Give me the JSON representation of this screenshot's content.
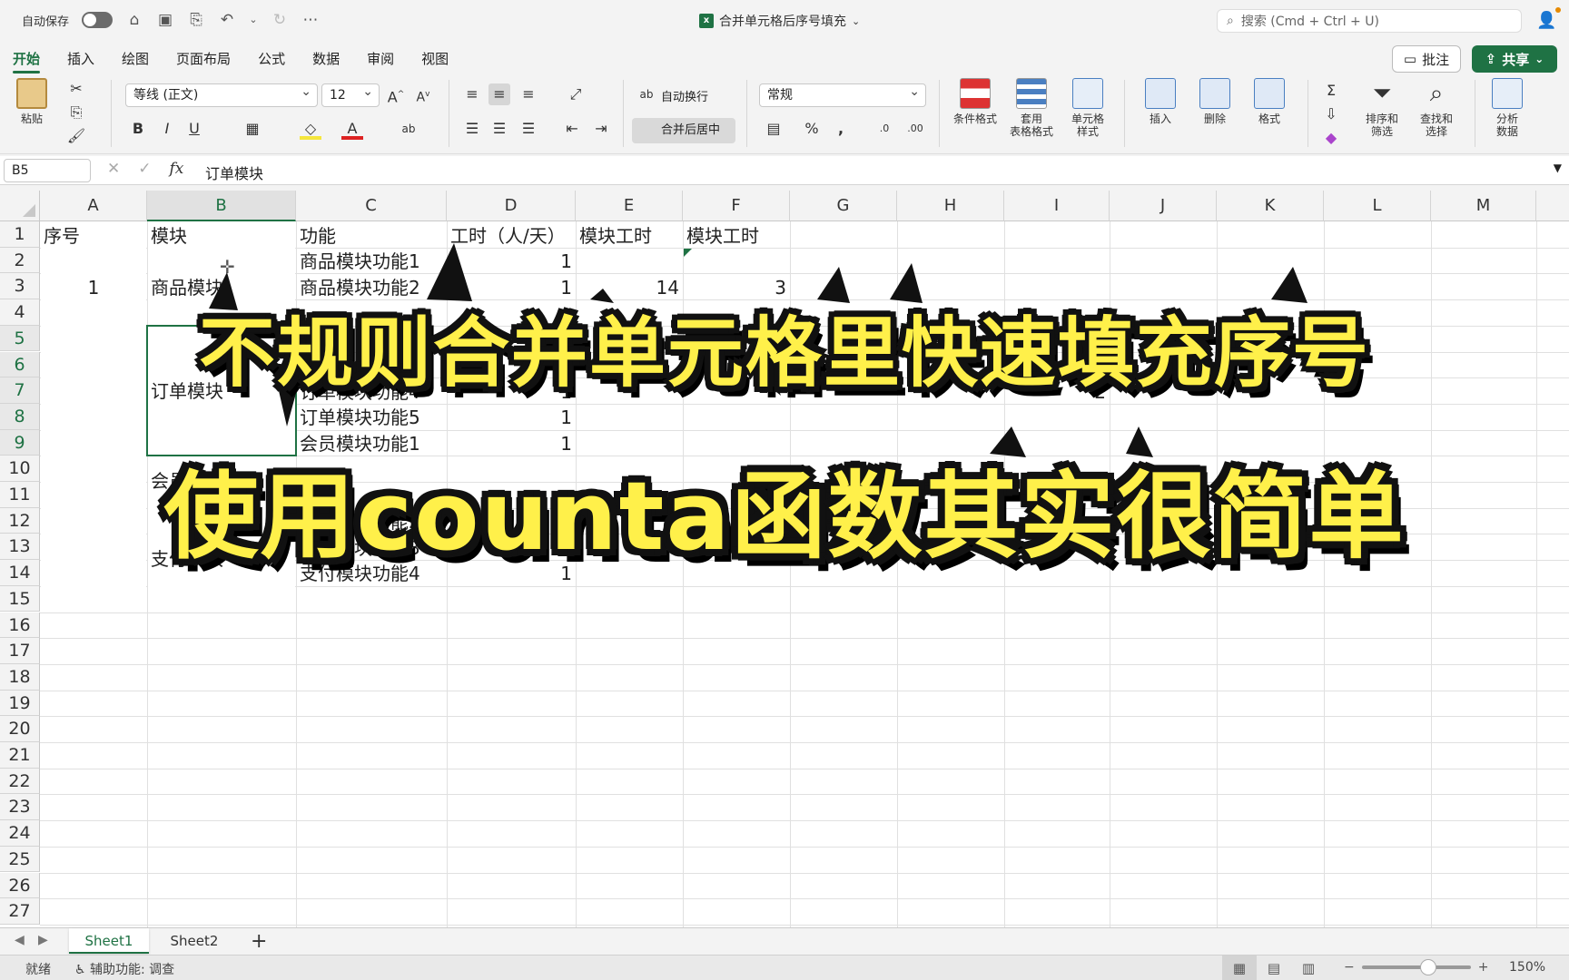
{
  "titlebar": {
    "autosave_label": "自动保存",
    "doc_title": "合并单元格后序号填充",
    "search_placeholder": "搜索 (Cmd + Ctrl + U)"
  },
  "ribbon_tabs": [
    "开始",
    "插入",
    "绘图",
    "页面布局",
    "公式",
    "数据",
    "审阅",
    "视图"
  ],
  "ribbon_buttons": {
    "comment": "批注",
    "share": "共享",
    "paste": "粘贴",
    "font_name": "等线 (正文)",
    "font_size": "12",
    "wrap_text": "自动换行",
    "merge_center": "合并后居中",
    "number_format": "常规",
    "conditional_format": "条件格式",
    "table_format_1": "套用",
    "table_format_2": "表格格式",
    "cell_style_1": "单元格",
    "cell_style_2": "样式",
    "insert": "插入",
    "delete": "删除",
    "format": "格式",
    "sort_filter_1": "排序和",
    "sort_filter_2": "筛选",
    "find_select_1": "查找和",
    "find_select_2": "选择",
    "analyze_1": "分析",
    "analyze_2": "数据"
  },
  "formula_bar": {
    "name_box": "B5",
    "content": "订单模块"
  },
  "columns": [
    "A",
    "B",
    "C",
    "D",
    "E",
    "F",
    "G",
    "H",
    "I",
    "J",
    "K",
    "L",
    "M"
  ],
  "rows": [
    "1",
    "2",
    "3",
    "4",
    "5",
    "6",
    "7",
    "8",
    "9",
    "10",
    "11",
    "12",
    "13",
    "14",
    "15",
    "16",
    "17",
    "18",
    "19",
    "20",
    "21",
    "22",
    "23",
    "24",
    "25",
    "26",
    "27"
  ],
  "cells": {
    "A1": "序号",
    "B1": "模块",
    "C1": "功能",
    "D1": "工时（人/天）",
    "E1": "模块工时",
    "F1": "模块工时",
    "A3": "1",
    "B_goods": "商品模块",
    "B_order": "订单模块",
    "B_member": "会员",
    "B_pay": "支付模块",
    "C2": "商品模块功能1",
    "C3": "商品模块功能2",
    "C7": "订单模块功能3",
    "C8": "订单模块功能4",
    "C9": "订单模块功能5",
    "C10": "会员模块功能1",
    "C13": "支付模块功能2",
    "C14": "支付模块功能3",
    "C15": "支付模块功能4",
    "D2": "1",
    "D3": "1",
    "D7": "1",
    "D8": "1",
    "D9": "1",
    "D10": "1",
    "D13": "1",
    "D14": "1",
    "D15": "1",
    "E3": "14",
    "F3": "3",
    "I7": "1",
    "I8": "2"
  },
  "overlay": {
    "line1": "不规则合并单元格里快速填充序号",
    "line2": "使用counta函数其实很简单"
  },
  "sheets": [
    "Sheet1",
    "Sheet2"
  ],
  "status": {
    "ready": "就绪",
    "accessibility": "辅助功能: 调查",
    "zoom": "150%"
  },
  "colors": {
    "accent": "#1f7244",
    "caption_fill": "#fff04a",
    "caption_outline": "#111111"
  }
}
